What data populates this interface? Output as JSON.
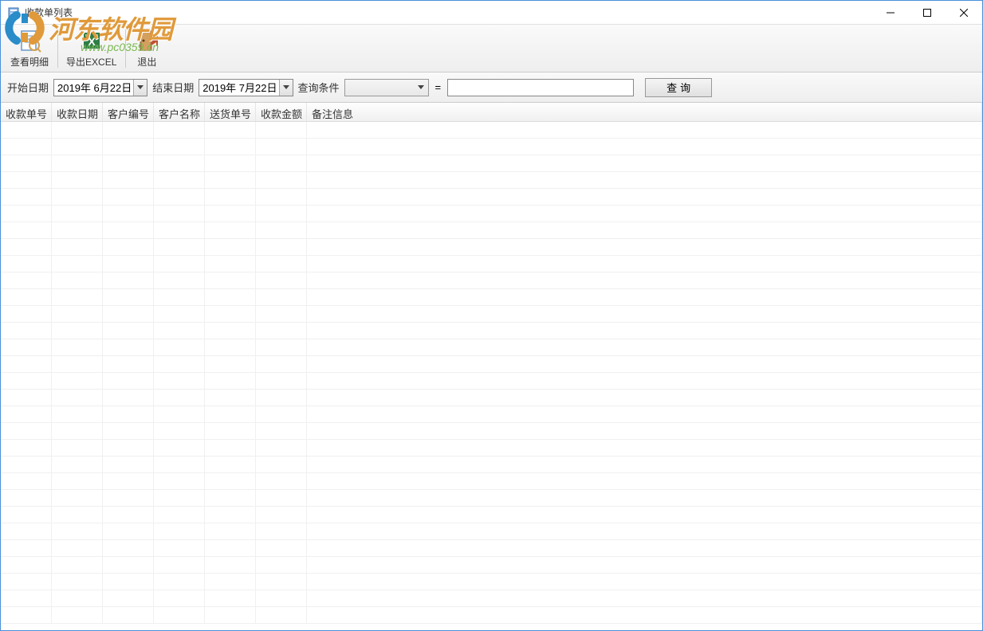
{
  "window": {
    "title": "收款单列表"
  },
  "watermark": {
    "main": "河东软件园",
    "sub": "www.pc0359.cn"
  },
  "toolbar": {
    "view_detail": "查看明细",
    "export_excel": "导出EXCEL",
    "exit": "退出"
  },
  "search": {
    "start_date_label": "开始日期",
    "start_date_value": "2019年 6月22日",
    "end_date_label": "结束日期",
    "end_date_value": "2019年 7月22日",
    "condition_label": "查询条件",
    "condition_value": "",
    "equals": "=",
    "input_value": "",
    "button_label": "查询"
  },
  "grid": {
    "columns": [
      "收款单号",
      "收款日期",
      "客户编号",
      "客户名称",
      "送货单号",
      "收款金额",
      "备注信息"
    ],
    "rows": []
  }
}
